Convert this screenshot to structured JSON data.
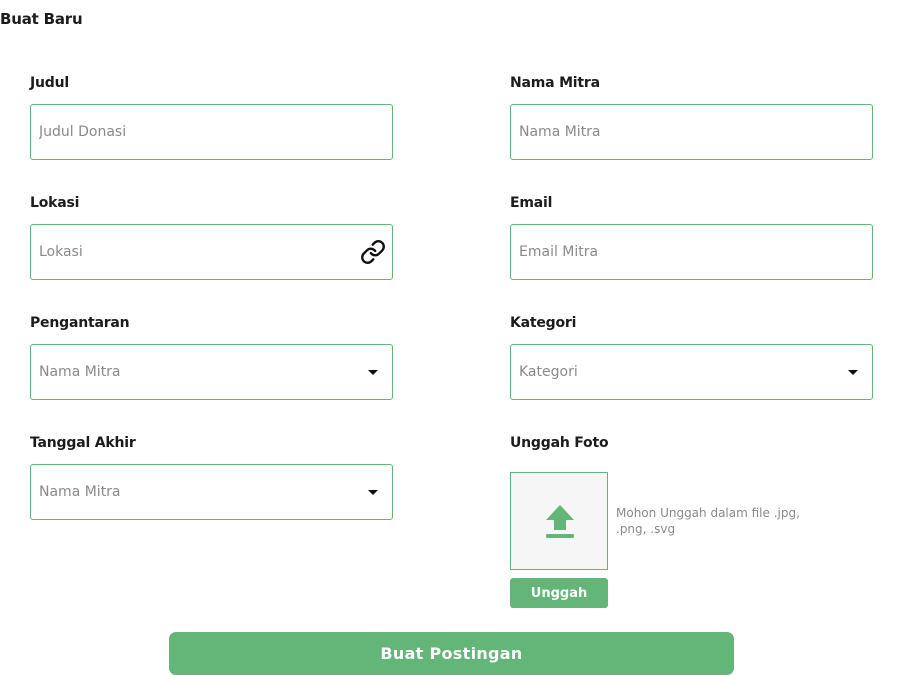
{
  "page": {
    "title": "Buat Baru"
  },
  "form": {
    "judul": {
      "label": "Judul",
      "placeholder": "Judul Donasi",
      "value": ""
    },
    "nama_mitra": {
      "label": "Nama Mitra",
      "placeholder": "Nama Mitra",
      "value": ""
    },
    "lokasi": {
      "label": "Lokasi",
      "placeholder": "Lokasi",
      "value": "",
      "icon": "link-icon"
    },
    "email": {
      "label": "Email",
      "placeholder": "Email Mitra",
      "value": ""
    },
    "pengantaran": {
      "label": "Pengantaran",
      "selected": "Nama Mitra",
      "icon": "chevron-down-icon"
    },
    "kategori": {
      "label": "Kategori",
      "selected": "Kategori",
      "icon": "chevron-down-icon"
    },
    "tanggal_akhir": {
      "label": "Tanggal Akhir",
      "selected": "Nama Mitra",
      "icon": "chevron-down-icon"
    },
    "unggah_foto": {
      "label": "Unggah Foto",
      "hint": "Mohon Unggah dalam file .jpg, .png, .svg",
      "button_label": "Unggah",
      "icon": "upload-icon"
    }
  },
  "actions": {
    "submit_label": "Buat Postingan"
  },
  "colors": {
    "accent": "#63b678",
    "text": "#1c1c1c",
    "placeholder": "#8a8a8a",
    "upload_bg": "#f6f6f6"
  }
}
